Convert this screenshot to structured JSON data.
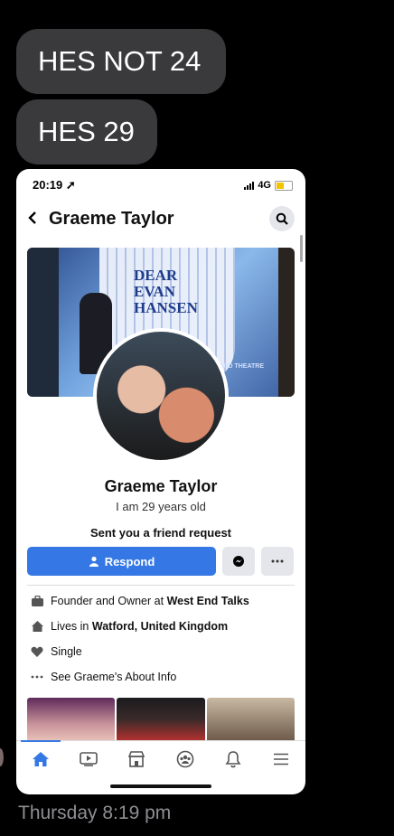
{
  "messages": [
    "HES NOT 24",
    "HES 29"
  ],
  "timestamp": "Thursday 8:19 pm",
  "phone": {
    "status": {
      "time": "20:19",
      "network": "4G"
    },
    "nav": {
      "title": "Graeme Taylor"
    },
    "cover": {
      "logo_lines": [
        "DEAR",
        "EVAN",
        "HANSEN"
      ],
      "theatre_text": "ARD THEATRE"
    },
    "profile": {
      "name": "Graeme Taylor",
      "bio": "I am 29 years old",
      "request_text": "Sent you a friend request",
      "respond_label": "Respond"
    },
    "info": {
      "work_prefix": "Founder and Owner at ",
      "work_place": "West End Talks",
      "lives_prefix": "Lives in ",
      "lives_place": "Watford, United Kingdom",
      "relationship": "Single",
      "about": "See Graeme's About Info"
    },
    "colors": {
      "accent": "#3578e5",
      "bubble": "#3a3a3c",
      "timestamp": "#8e8e93"
    },
    "tabs": [
      "home-icon",
      "watch-icon",
      "marketplace-icon",
      "groups-icon",
      "notifications-icon",
      "menu-icon"
    ]
  }
}
